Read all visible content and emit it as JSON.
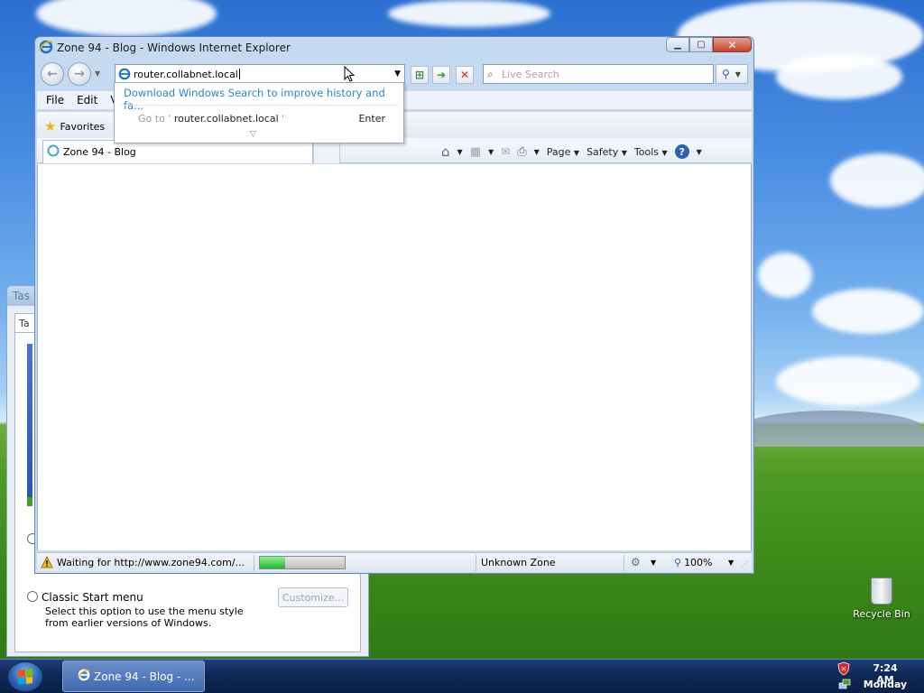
{
  "window": {
    "title": "Zone 94 - Blog - Windows Internet Explorer",
    "minimize_glyph": "▁",
    "maximize_glyph": "▢",
    "close_glyph": "✕"
  },
  "address": {
    "value": "router.collabnet.local"
  },
  "search": {
    "placeholder": "Live Search"
  },
  "autocomplete": {
    "suggestion": "Download Windows Search to improve history and fa...",
    "goto_prefix": "Go to ' ",
    "goto_target": "router.collabnet.local",
    "goto_suffix": " '",
    "enter_label": "Enter"
  },
  "menu": {
    "file": "File",
    "edit": "Edit",
    "view": "V"
  },
  "favorites": {
    "label": "Favorites"
  },
  "tab": {
    "label": "Zone 94 - Blog"
  },
  "commands": {
    "page": "Page",
    "safety": "Safety",
    "tools": "Tools",
    "help_glyph": "?"
  },
  "status": {
    "text": "Waiting for http://www.zone94.com/...",
    "progress": 0.3,
    "zone": "Unknown Zone",
    "zoom": "100%"
  },
  "background_dialog": {
    "title": "Tas",
    "tab_label": "Ta",
    "option_label": "Classic Start menu",
    "option_description": "Select this option to use the menu style from earlier versions of Windows.",
    "customize_button": "Customize..."
  },
  "desktop": {
    "recycle_bin_label": "Recycle Bin"
  },
  "taskbar": {
    "item_label": "Zone 94 - Blog - ...",
    "time": "7:24 AM",
    "day": "Monday"
  },
  "colors": {
    "link": "#2a86c9",
    "progress_fill": "#1fb62f",
    "close_button": "#c5442a"
  }
}
